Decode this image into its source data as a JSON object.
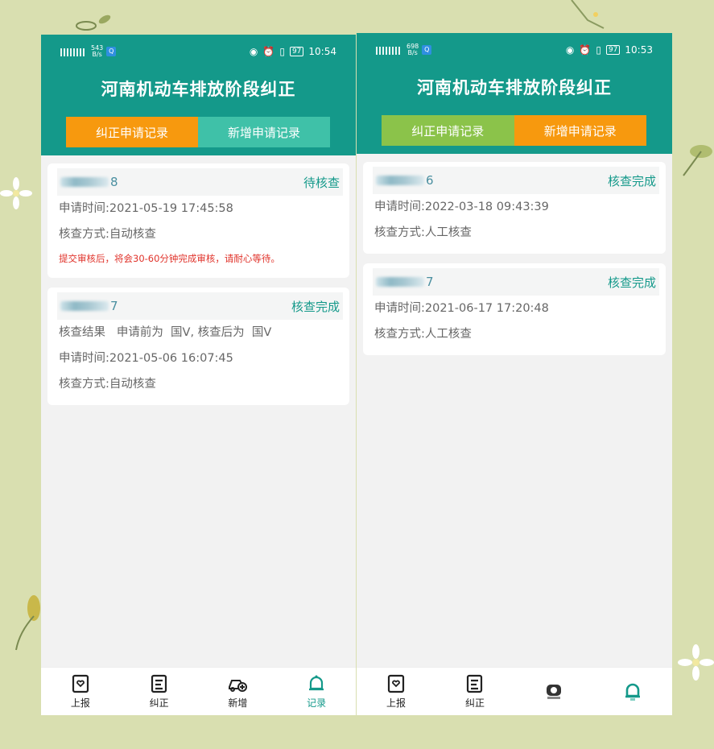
{
  "colors": {
    "header": "#14998a",
    "orange": "#f7990e",
    "teal_tab": "#3fc1a8",
    "green_tab": "#8bc34a",
    "warning": "#e0322a",
    "background": "#d9dfb0"
  },
  "left": {
    "status": {
      "speed": "543\nB/s",
      "time": "10:54",
      "battery": "97"
    },
    "title": "河南机动车排放阶段纠正",
    "tabs": [
      "纠正申请记录",
      "新增申请记录"
    ],
    "cards": [
      {
        "plate_suffix": "8",
        "status": "待核查",
        "time": "申请时间:2021-05-19 17:45:58",
        "method": "核查方式:自动核查",
        "warning": "提交审核后，将会30-60分钟完成审核，请耐心等待。"
      },
      {
        "plate_suffix": "7",
        "status": "核查完成",
        "result": "核查结果   申请前为  国V, 核查后为  国V",
        "time": "申请时间:2021-05-06 16:07:45",
        "method": "核查方式:自动核查"
      }
    ],
    "nav": [
      "上报",
      "纠正",
      "新增",
      "记录"
    ]
  },
  "right": {
    "status": {
      "speed": "698\nB/s",
      "time": "10:53",
      "battery": "97"
    },
    "title": "河南机动车排放阶段纠正",
    "tabs": [
      "纠正申请记录",
      "新增申请记录"
    ],
    "cards": [
      {
        "plate_suffix": "6",
        "status": "核查完成",
        "time": "申请时间:2022-03-18 09:43:39",
        "method": "核查方式:人工核查"
      },
      {
        "plate_suffix": "7",
        "status": "核查完成",
        "time": "申请时间:2021-06-17 17:20:48",
        "method": "核查方式:人工核查"
      }
    ],
    "nav": [
      "上报",
      "纠正",
      "",
      ""
    ]
  }
}
